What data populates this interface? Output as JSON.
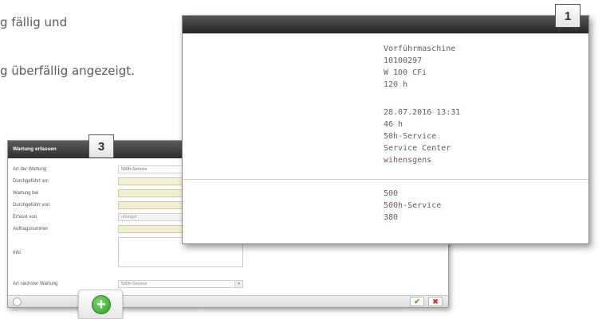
{
  "background_text": {
    "line1": "g fällig und",
    "line2": "g überfällig angezeigt."
  },
  "dialog3": {
    "badge": "3",
    "title": "Wartung erfassen",
    "rows": [
      {
        "label": "Art der Wartung",
        "value": "500h-Service"
      },
      {
        "label": "Durchgeführt am",
        "value": ""
      },
      {
        "label": "Wartung bei",
        "value": ""
      },
      {
        "label": "Durchgeführt von",
        "value": ""
      },
      {
        "label": "Erfasst von",
        "value": "uthingst"
      },
      {
        "label": "Auftragsnummer",
        "value": ""
      },
      {
        "label": "Info",
        "value": ""
      },
      {
        "label": "Art nächster Wartung",
        "value": "500h-Service"
      }
    ],
    "ok_label": "✔",
    "cancel_label": "✖",
    "add_label": "+"
  },
  "dialog1": {
    "badge": "1",
    "sections": [
      {
        "lines": [
          "Vorführmaschine",
          "10100297",
          "W 100 CFi",
          "120 h"
        ]
      },
      {
        "lines": [
          "28.07.2016 13:31",
          "46 h",
          "50h-Service",
          "Service Center",
          "wihensgens"
        ]
      },
      {
        "lines": [
          "500",
          "500h-Service",
          "380"
        ]
      }
    ]
  }
}
